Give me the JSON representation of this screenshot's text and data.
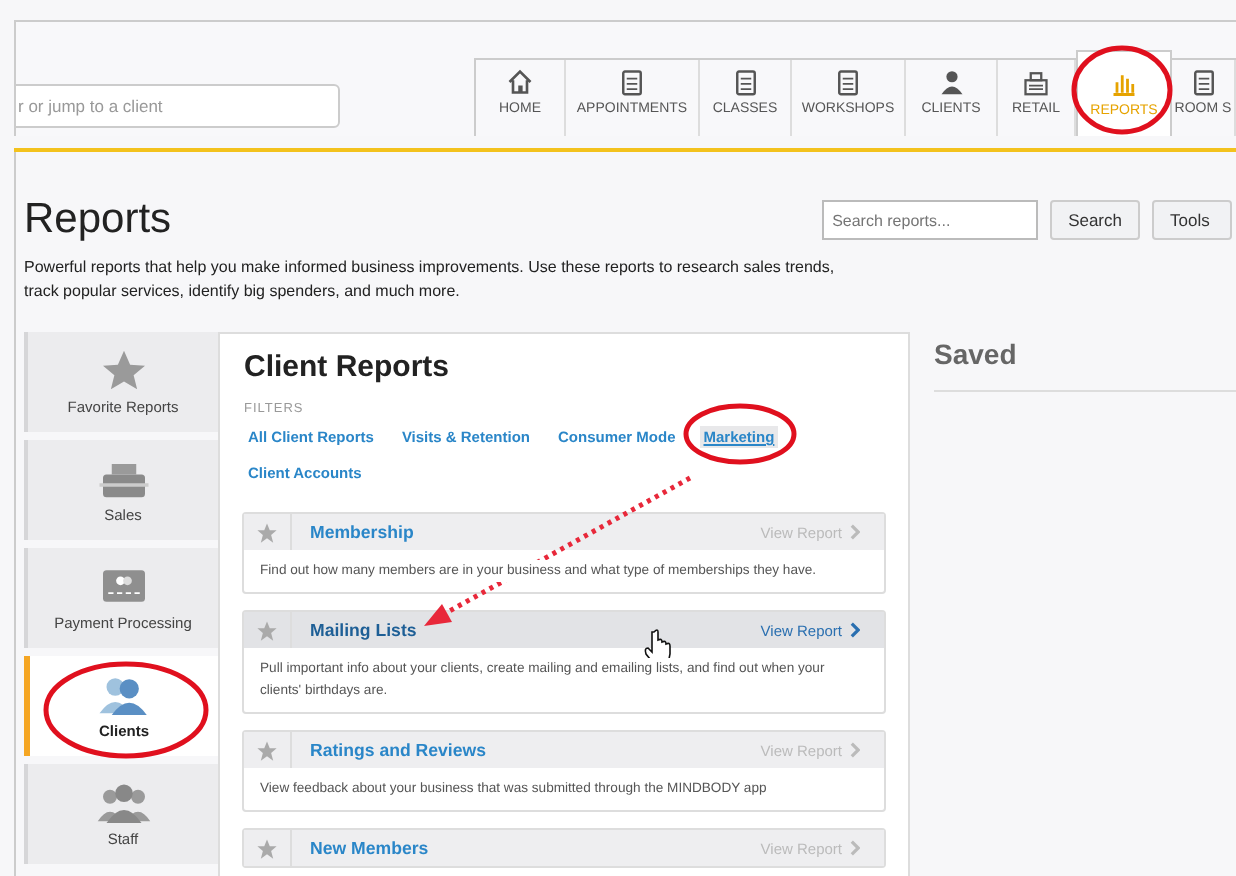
{
  "search": {
    "placeholder": "r or jump to a client"
  },
  "nav": [
    {
      "label": "HOME",
      "selected": false
    },
    {
      "label": "APPOINTMENTS",
      "selected": false
    },
    {
      "label": "CLASSES",
      "selected": false
    },
    {
      "label": "WORKSHOPS",
      "selected": false
    },
    {
      "label": "CLIENTS",
      "selected": false
    },
    {
      "label": "RETAIL",
      "selected": false
    },
    {
      "label": "REPORTS",
      "selected": true
    },
    {
      "label": "ROOM S",
      "selected": false
    }
  ],
  "page": {
    "title": "Reports",
    "description": "Powerful reports that help you make informed business improvements. Use these reports to research sales trends, track popular services, identify big spenders, and much more.",
    "search_placeholder": "Search reports...",
    "search_button": "Search",
    "tools_button": "Tools"
  },
  "categories": [
    {
      "label": "Favorite Reports",
      "selected": false
    },
    {
      "label": "Sales",
      "selected": false
    },
    {
      "label": "Payment Processing",
      "selected": false
    },
    {
      "label": "Clients",
      "selected": true
    },
    {
      "label": "Staff",
      "selected": false
    }
  ],
  "panel": {
    "title": "Client Reports",
    "filters_label": "FILTERS",
    "filters": [
      {
        "label": "All Client Reports",
        "selected": false
      },
      {
        "label": "Visits & Retention",
        "selected": false
      },
      {
        "label": "Consumer Mode",
        "selected": false
      },
      {
        "label": "Marketing",
        "selected": true
      },
      {
        "label": "Client Accounts",
        "selected": false
      }
    ],
    "reports": [
      {
        "title": "Membership",
        "action": "View Report",
        "highlighted": false,
        "description": "Find out how many members are in your business and what type of memberships they have."
      },
      {
        "title": "Mailing Lists",
        "action": "View Report",
        "highlighted": true,
        "description": "Pull important info about your clients, create mailing and emailing lists, and find out when your clients' birthdays are."
      },
      {
        "title": "Ratings and Reviews",
        "action": "View Report",
        "highlighted": false,
        "description": "View feedback about your business that was submitted through the MINDBODY app"
      },
      {
        "title": "New Members",
        "action": "View Report",
        "highlighted": false
      }
    ]
  },
  "saved": {
    "title": "Saved"
  }
}
